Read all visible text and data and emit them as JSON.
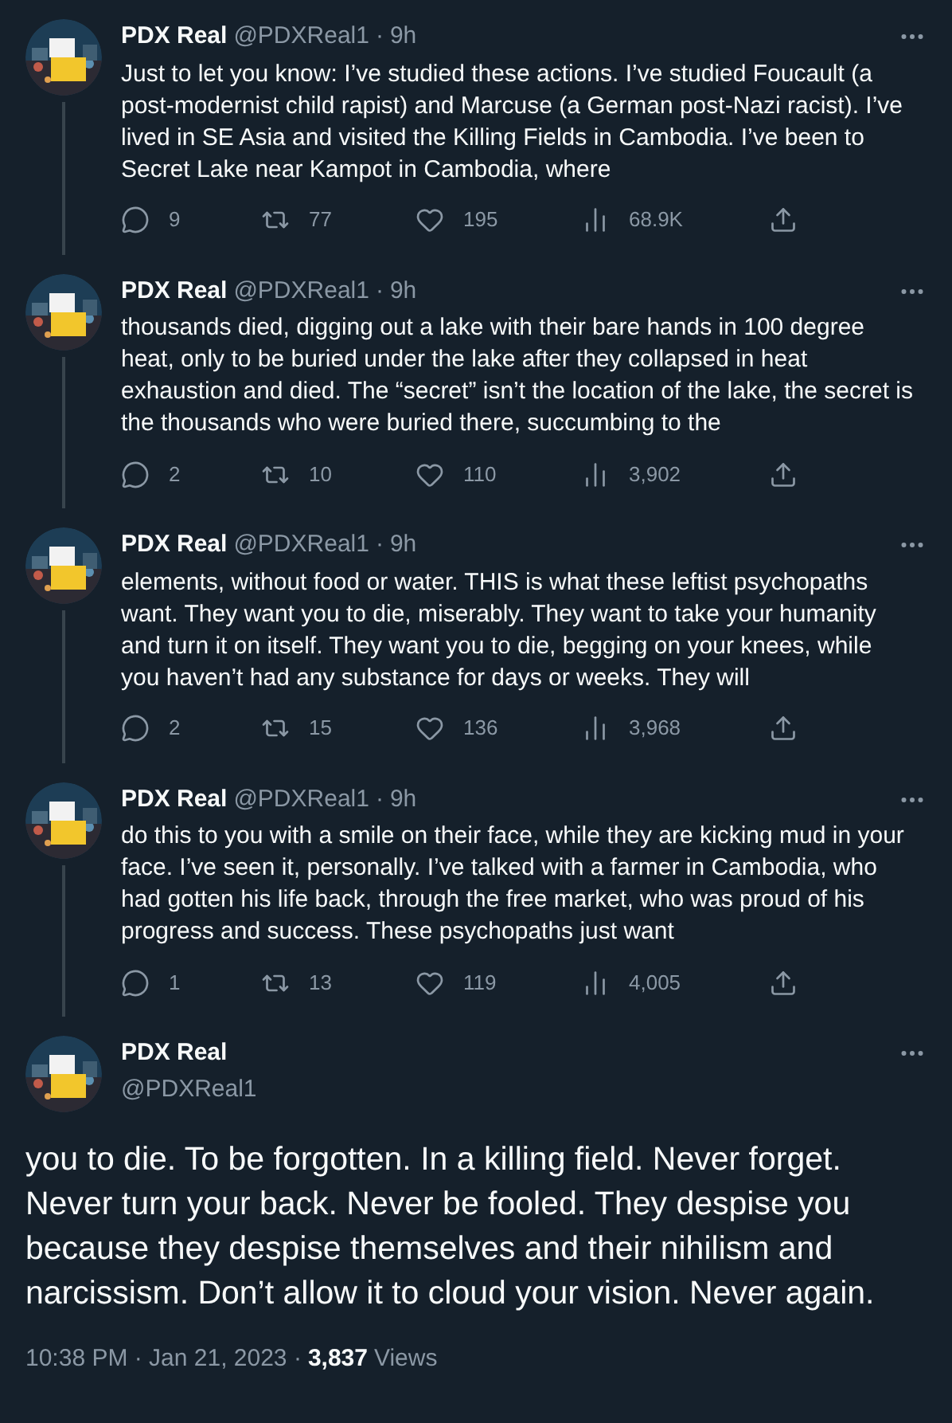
{
  "thread": [
    {
      "name": "PDX Real",
      "handle": "@PDXReal1",
      "time": "9h",
      "separator": "·",
      "text": "Just to let you know: I’ve studied these actions. I’ve studied Foucault (a post-modernist child rapist) and Marcuse (a German post-Nazi racist). I’ve lived in SE Asia and visited the Killing Fields in Cambodia. I’ve been to Secret Lake near Kampot in Cambodia, where",
      "replies": "9",
      "retweets": "77",
      "likes": "195",
      "views": "68.9K"
    },
    {
      "name": "PDX Real",
      "handle": "@PDXReal1",
      "time": "9h",
      "separator": "·",
      "text": "thousands died, digging out a lake with their bare hands in 100 degree heat, only to be buried under the lake after they collapsed in heat exhaustion and died. The “secret” isn’t the location of the lake, the secret is the thousands who were buried there, succumbing to the",
      "replies": "2",
      "retweets": "10",
      "likes": "110",
      "views": "3,902"
    },
    {
      "name": "PDX Real",
      "handle": "@PDXReal1",
      "time": "9h",
      "separator": "·",
      "text": "elements, without food or water. THIS is what these leftist psychopaths want. They want you to die, miserably. They want to take your humanity and turn it on itself. They want you to die, begging on your knees, while you haven’t had any substance for days or weeks. They will",
      "replies": "2",
      "retweets": "15",
      "likes": "136",
      "views": "3,968"
    },
    {
      "name": "PDX Real",
      "handle": "@PDXReal1",
      "time": "9h",
      "separator": "·",
      "text": "do this to you with a smile on their face, while they are kicking mud in your face. I’ve seen it, personally. I’ve talked with a farmer in Cambodia, who had gotten his life back, through the free market, who was proud of his progress and success. These psychopaths just want",
      "replies": "1",
      "retweets": "13",
      "likes": "119",
      "views": "4,005"
    }
  ],
  "main_tweet": {
    "name": "PDX Real",
    "handle": "@PDXReal1",
    "text": "you to die. To be forgotten. In a killing field. Never forget. Never turn your back. Never be fooled. They despise you because they despise themselves and their nihilism and narcissism. Don’t allow it to cloud your vision. Never again.",
    "timestamp": "10:38 PM · Jan 21, 2023 ·",
    "views_count": "3,837",
    "views_label": "Views"
  }
}
